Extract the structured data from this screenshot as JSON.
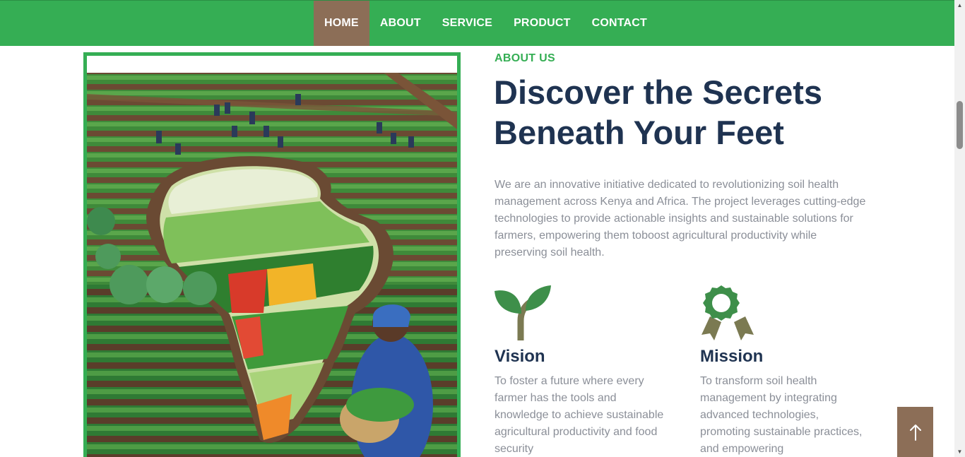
{
  "nav": {
    "items": [
      {
        "label": "HOME",
        "active": true
      },
      {
        "label": "ABOUT",
        "active": false
      },
      {
        "label": "SERVICE",
        "active": false
      },
      {
        "label": "PRODUCT",
        "active": false
      },
      {
        "label": "CONTACT",
        "active": false
      }
    ]
  },
  "about": {
    "eyebrow": "ABOUT US",
    "headline_line1": "Discover the Secrets",
    "headline_line2": "Beneath Your Feet",
    "intro": "We are an innovative initiative dedicated to revolutionizing soil health management across Kenya and Africa. The project leverages cutting-edge technologies to provide actionable insights and sustainable solutions for farmers, empowering them toboost agricultural productivity while preserving soil health."
  },
  "features": {
    "vision": {
      "icon": "sprout-icon",
      "title": "Vision",
      "text": "To foster a future where every farmer has the tools and knowledge to achieve sustainable agricultural productivity and food security"
    },
    "mission": {
      "icon": "award-ribbon-icon",
      "title": "Mission",
      "text": "To transform soil health management by integrating advanced technologies, promoting sustainable practices, and empowering"
    }
  },
  "colors": {
    "brand_green": "#35ae54",
    "accent_brown": "#8c6e57",
    "heading_navy": "#1f3351",
    "body_gray": "#8b8f98"
  }
}
